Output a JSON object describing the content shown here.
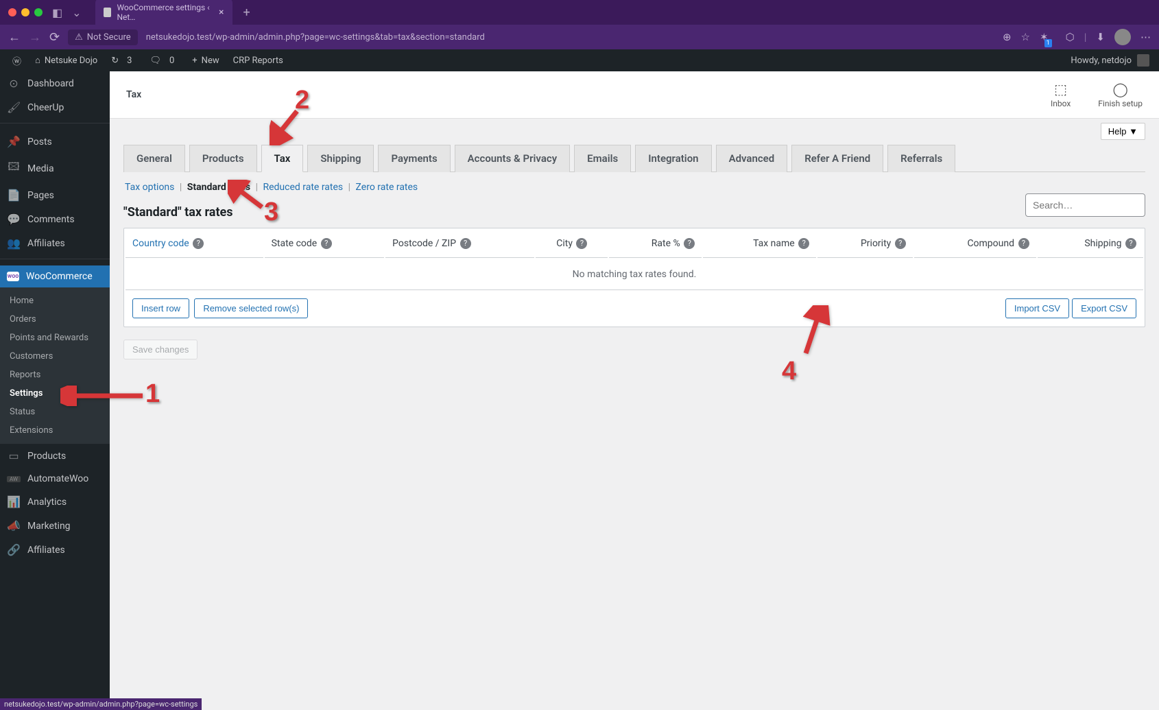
{
  "browser": {
    "tab_title": "WooCommerce settings ‹ Net…",
    "security_label": "Not Secure",
    "url": "netsukedojo.test/wp-admin/admin.php?page=wc-settings&tab=tax&section=standard",
    "status_url": "netsukedojo.test/wp-admin/admin.php?page=wc-settings"
  },
  "toolbar": {
    "site_name": "Netsuke Dojo",
    "updates_count": "3",
    "comments_count": "0",
    "new_label": "New",
    "crp_label": "CRP Reports",
    "howdy": "Howdy, netdojo"
  },
  "sidebar": {
    "items": [
      {
        "label": "Dashboard",
        "icon": "🏠"
      },
      {
        "label": "CheerUp",
        "icon": "🖌️"
      },
      {
        "label": "Posts",
        "icon": "📌"
      },
      {
        "label": "Media",
        "icon": "🖼️"
      },
      {
        "label": "Pages",
        "icon": "📄"
      },
      {
        "label": "Comments",
        "icon": "💬"
      },
      {
        "label": "Affiliates",
        "icon": "👥"
      },
      {
        "label": "WooCommerce",
        "icon": "W",
        "current": true
      },
      {
        "label": "Products",
        "icon": "📦"
      },
      {
        "label": "AutomateWoo",
        "icon": "AW"
      },
      {
        "label": "Analytics",
        "icon": "📊"
      },
      {
        "label": "Marketing",
        "icon": "📣"
      },
      {
        "label": "Affiliates",
        "icon": "🔗"
      }
    ],
    "submenu": [
      "Home",
      "Orders",
      "Points and Rewards",
      "Customers",
      "Reports",
      "Settings",
      "Status",
      "Extensions"
    ],
    "submenu_active": "Settings"
  },
  "page": {
    "title": "Tax",
    "header_actions": {
      "inbox": "Inbox",
      "finish": "Finish setup"
    },
    "help_btn": "Help ▼",
    "tabs": [
      "General",
      "Products",
      "Tax",
      "Shipping",
      "Payments",
      "Accounts & Privacy",
      "Emails",
      "Integration",
      "Advanced",
      "Refer A Friend",
      "Referrals"
    ],
    "active_tab": "Tax",
    "subtabs": [
      "Tax options",
      "Standard rates",
      "Reduced rate rates",
      "Zero rate rates"
    ],
    "active_subtab": "Standard rates",
    "section_heading": "\"Standard\" tax rates",
    "search_placeholder": "Search…",
    "columns": [
      "Country code",
      "State code",
      "Postcode / ZIP",
      "City",
      "Rate %",
      "Tax name",
      "Priority",
      "Compound",
      "Shipping"
    ],
    "empty_text": "No matching tax rates found.",
    "buttons": {
      "insert": "Insert row",
      "remove": "Remove selected row(s)",
      "import": "Import CSV",
      "export": "Export CSV",
      "save": "Save changes"
    }
  },
  "annotations": {
    "1": "1",
    "2": "2",
    "3": "3",
    "4": "4"
  }
}
